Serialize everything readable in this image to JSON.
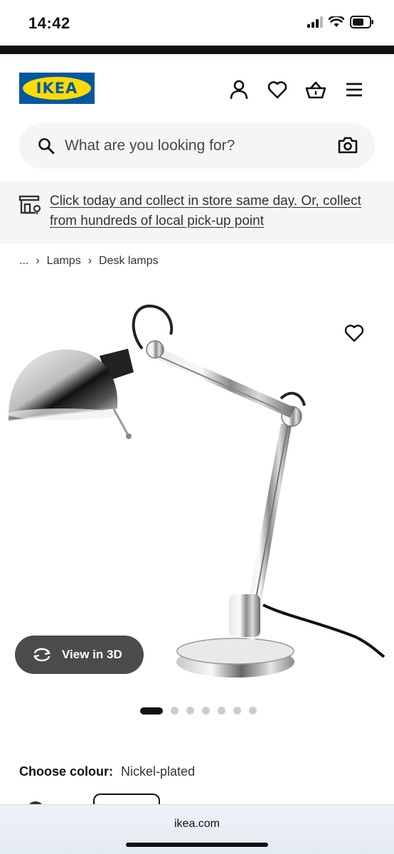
{
  "status": {
    "time": "14:42"
  },
  "header": {
    "logo_text": "IKEA"
  },
  "search": {
    "placeholder": "What are you looking for?"
  },
  "banner": {
    "text": "Click today and collect in store same day. Or, collect from hundreds of local pick-up point"
  },
  "breadcrumb": {
    "ellipsis": "...",
    "items": [
      "Lamps",
      "Desk lamps"
    ]
  },
  "product": {
    "view3d_label": "View in 3D",
    "image_count": 7,
    "active_image": 1
  },
  "colour": {
    "label": "Choose colour:",
    "value": "Nickel-plated"
  },
  "browser": {
    "url": "ikea.com"
  },
  "colors": {
    "ikea_blue": "#0058a3",
    "ikea_yellow": "#ffdb00",
    "banner_bg": "#f5f5f5",
    "view3d_bg": "#4b4b4b"
  }
}
